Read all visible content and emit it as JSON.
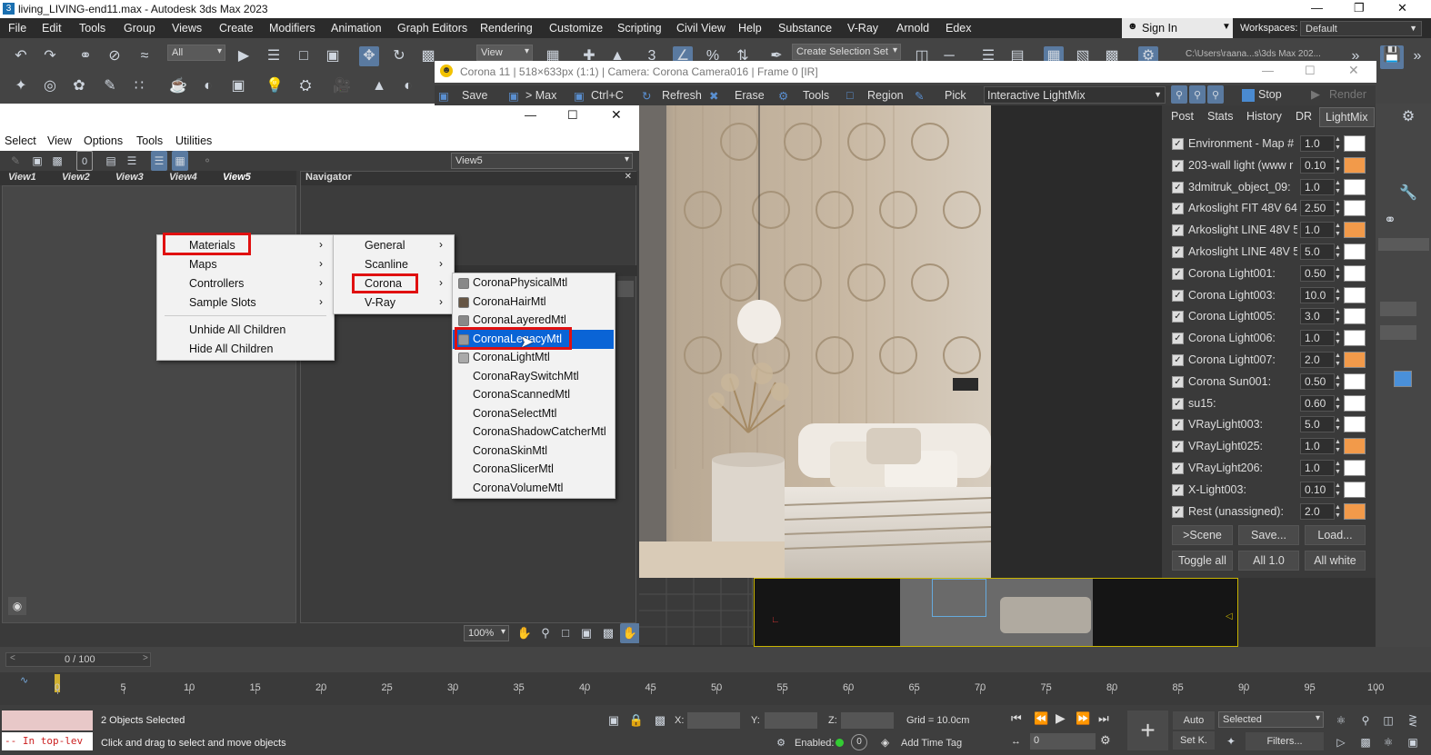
{
  "app": {
    "title": "living_LIVING-end11.max - Autodesk 3ds Max 2023",
    "menu": [
      "File",
      "Edit",
      "Tools",
      "Group",
      "Views",
      "Create",
      "Modifiers",
      "Animation",
      "Graph Editors",
      "Rendering",
      "Customize",
      "Scripting",
      "Civil View",
      "Help",
      "Substance",
      "V-Ray",
      "Arnold",
      "Edex"
    ],
    "sign_in": "Sign In",
    "workspaces_label": "Workspaces:",
    "workspace": "Default",
    "selection_filter": "All",
    "ref_coord": "View",
    "selection_set": "Create Selection Set",
    "path": "C:\\Users\\raana...s\\3ds Max 202..."
  },
  "slate": {
    "menu": [
      "Select",
      "View",
      "Options",
      "Tools",
      "Utilities"
    ],
    "view_dropdown": "View5",
    "tabs": [
      "View1",
      "View2",
      "View3",
      "View4",
      "View5"
    ],
    "navigator_title": "Navigator",
    "zoom": "100%"
  },
  "context_menu": {
    "main": [
      "Materials",
      "Maps",
      "Controllers",
      "Sample Slots"
    ],
    "extra": [
      "Unhide All Children",
      "Hide All Children"
    ],
    "sub1": [
      "General",
      "Scanline",
      "Corona",
      "V-Ray"
    ],
    "corona_items": [
      "CoronaPhysicalMtl",
      "CoronaHairMtl",
      "CoronaLayeredMtl",
      "CoronaLegacyMtl",
      "CoronaLightMtl",
      "CoronaRaySwitchMtl",
      "CoronaScannedMtl",
      "CoronaSelectMtl",
      "CoronaShadowCatcherMtl",
      "CoronaSkinMtl",
      "CoronaSlicerMtl",
      "CoronaVolumeMtl"
    ]
  },
  "vfb": {
    "title": "Corona 11 | 518×633px (1:1) | Camera: Corona Camera016 | Frame 0 [IR]",
    "toolbar": {
      "save": "Save",
      "max": "> Max",
      "copy": "Ctrl+C",
      "refresh": "Refresh",
      "erase": "Erase",
      "tools": "Tools",
      "region": "Region",
      "pick": "Pick",
      "mode": "Interactive LightMix",
      "stop": "Stop",
      "render": "Render"
    },
    "tabs": [
      "Post",
      "Stats",
      "History",
      "DR",
      "LightMix"
    ],
    "lightmix": [
      {
        "name": "Environment - Map #",
        "value": "1.0",
        "color": "#ffffff"
      },
      {
        "name": "203-wall light (www r",
        "value": "0.10",
        "color": "#f29a4a"
      },
      {
        "name": "3dmitruk_object_09:",
        "value": "1.0",
        "color": "#ffffff"
      },
      {
        "name": "Arkoslight FIT 48V 64(",
        "value": "2.50",
        "color": "#ffffff"
      },
      {
        "name": "Arkoslight LINE 48V 5",
        "value": "1.0",
        "color": "#f29a4a"
      },
      {
        "name": "Arkoslight LINE 48V 5",
        "value": "5.0",
        "color": "#ffffff"
      },
      {
        "name": "Corona Light001:",
        "value": "0.50",
        "color": "#ffffff"
      },
      {
        "name": "Corona Light003:",
        "value": "10.0",
        "color": "#ffffff"
      },
      {
        "name": "Corona Light005:",
        "value": "3.0",
        "color": "#ffffff"
      },
      {
        "name": "Corona Light006:",
        "value": "1.0",
        "color": "#ffffff"
      },
      {
        "name": "Corona Light007:",
        "value": "2.0",
        "color": "#f29a4a"
      },
      {
        "name": "Corona Sun001:",
        "value": "0.50",
        "color": "#ffffff"
      },
      {
        "name": "su15:",
        "value": "0.60",
        "color": "#ffffff"
      },
      {
        "name": "VRayLight003:",
        "value": "5.0",
        "color": "#ffffff"
      },
      {
        "name": "VRayLight025:",
        "value": "1.0",
        "color": "#f29a4a"
      },
      {
        "name": "VRayLight206:",
        "value": "1.0",
        "color": "#ffffff"
      },
      {
        "name": "X-Light003:",
        "value": "0.10",
        "color": "#ffffff"
      },
      {
        "name": "Rest (unassigned):",
        "value": "2.0",
        "color": "#f29a4a"
      }
    ],
    "buttons": [
      ">Scene",
      "Save...",
      "Load...",
      "Toggle all",
      "All 1.0",
      "All white"
    ]
  },
  "timeline": {
    "frame": "0 / 100",
    "ticks": [
      "0",
      "5",
      "10",
      "15",
      "20",
      "25",
      "30",
      "35",
      "40",
      "45",
      "50",
      "55",
      "60",
      "65",
      "70",
      "75",
      "80",
      "85",
      "90",
      "95",
      "100"
    ]
  },
  "status": {
    "selected": "2 Objects Selected",
    "prompt": "Click and drag to select and move objects",
    "script": "-- In top-lev",
    "x_label": "X:",
    "y_label": "Y:",
    "z_label": "Z:",
    "grid": "Grid = 10.0cm",
    "enabled": "Enabled:",
    "add_time_tag": "Add Time Tag",
    "auto": "Auto",
    "selected_dd": "Selected",
    "setk": "Set K.",
    "filters": "Filters...",
    "frame_field": "0"
  }
}
